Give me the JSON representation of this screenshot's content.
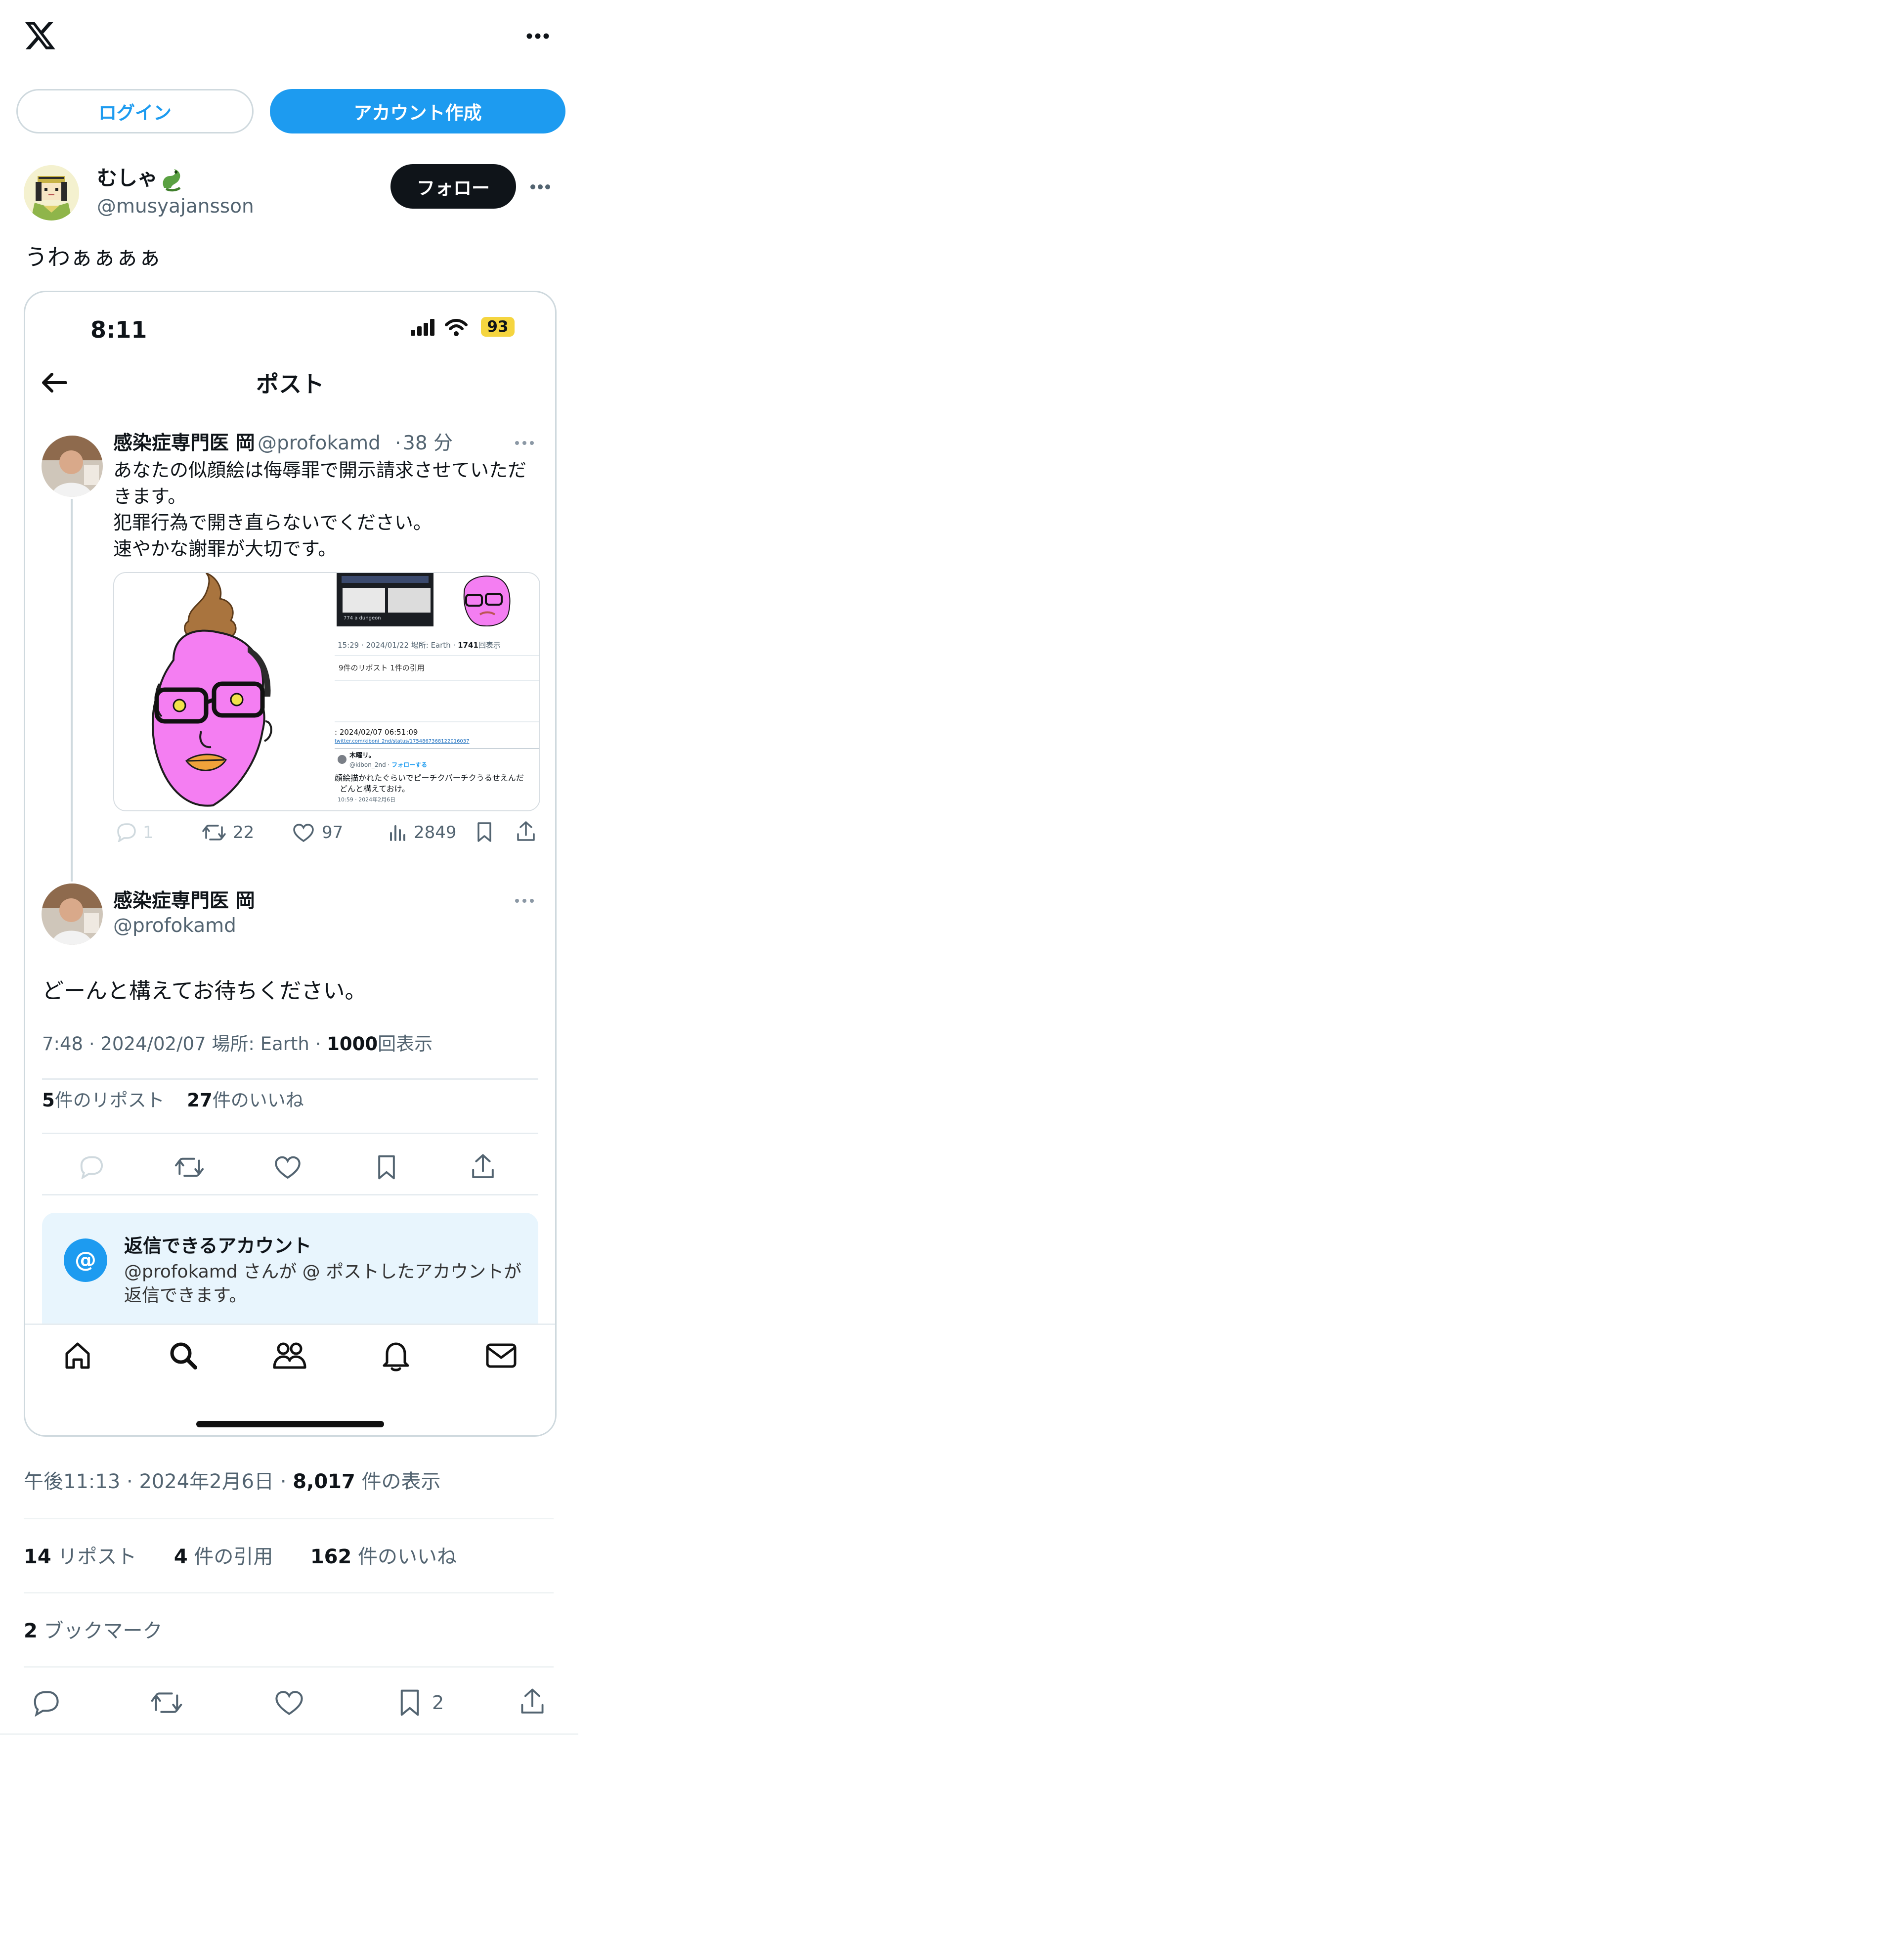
{
  "header": {
    "logo_icon": "x-logo-icon",
    "more_icon": "more-horizontal-icon"
  },
  "auth": {
    "login_label": "ログイン",
    "signup_label": "アカウント作成",
    "accent": "#1d9bf0"
  },
  "author": {
    "name": "むしゃ",
    "emoji_icon": "dragon-icon",
    "handle": "@musyajansson",
    "follow_label": "フォロー"
  },
  "post": {
    "text": "うわぁぁぁぁ",
    "time": "午後11:13",
    "date": "2024年2月6日",
    "views_count": "8,017",
    "views_label": "件の表示",
    "reposts_count": "14",
    "reposts_label": "リポスト",
    "quotes_count": "4",
    "quotes_label": "件の引用",
    "likes_count": "162",
    "likes_label": "件のいいね",
    "bookmarks_count": "2",
    "bookmarks_label": "ブックマーク",
    "action_bookmark_count": "2"
  },
  "screenshot": {
    "status_time": "8:11",
    "battery": "93",
    "nav_title": "ポスト",
    "tweet1": {
      "name": "感染症専門医 岡",
      "handle": "@profokamd",
      "sep": "·",
      "age": "38 分",
      "lines": [
        "あなたの似顔絵は侮辱罪で開示請求させていただ",
        "きます。",
        "犯罪行為で開き直らないでください。",
        "速やかな謝罪が大切です。"
      ],
      "embedded": {
        "time_line": "15:29 · 2024/01/22 場所: Earth · ",
        "time_views": "1741",
        "time_views_label": "回表示",
        "reposts_line": "9件のリポスト 1件の引用",
        "date_line": ": 2024/02/07 06:51:09",
        "link_line": "twitter.com/kiboni_2nd/status/1754867368122016037",
        "quote_name": "木曜リ。",
        "quote_handle": "@kibon_2nd · ",
        "quote_follow": "フォローする",
        "quote_text1": "顔絵描かれたぐらいでピーチクパーチクうるせえんだ",
        "quote_text2": "どんと構えておけ。",
        "quote_time": "10:59 · 2024年2月6日",
        "small_tweet": "774 a dungeon"
      },
      "stats": {
        "replies": "1",
        "reposts": "22",
        "likes": "97",
        "views": "2849"
      }
    },
    "tweet2": {
      "name": "感染症専門医 岡",
      "handle": "@profokamd",
      "text": "どーんと構えてお待ちください。",
      "meta_prefix": "7:48 · 2024/02/07 場所: Earth · ",
      "meta_views": "1000",
      "meta_views_label": "回表示",
      "reposts_count": "5",
      "reposts_label": "件のリポスト",
      "likes_count": "27",
      "likes_label": "件のいいね"
    },
    "reply_notice": {
      "title": "返信できるアカウント",
      "line1": "@profokamd さんが @ ポストしたアカウントが",
      "line2": "返信できます。",
      "at_symbol": "@"
    },
    "tabbar": [
      "home-icon",
      "search-icon",
      "communities-icon",
      "notifications-icon",
      "messages-icon"
    ]
  }
}
